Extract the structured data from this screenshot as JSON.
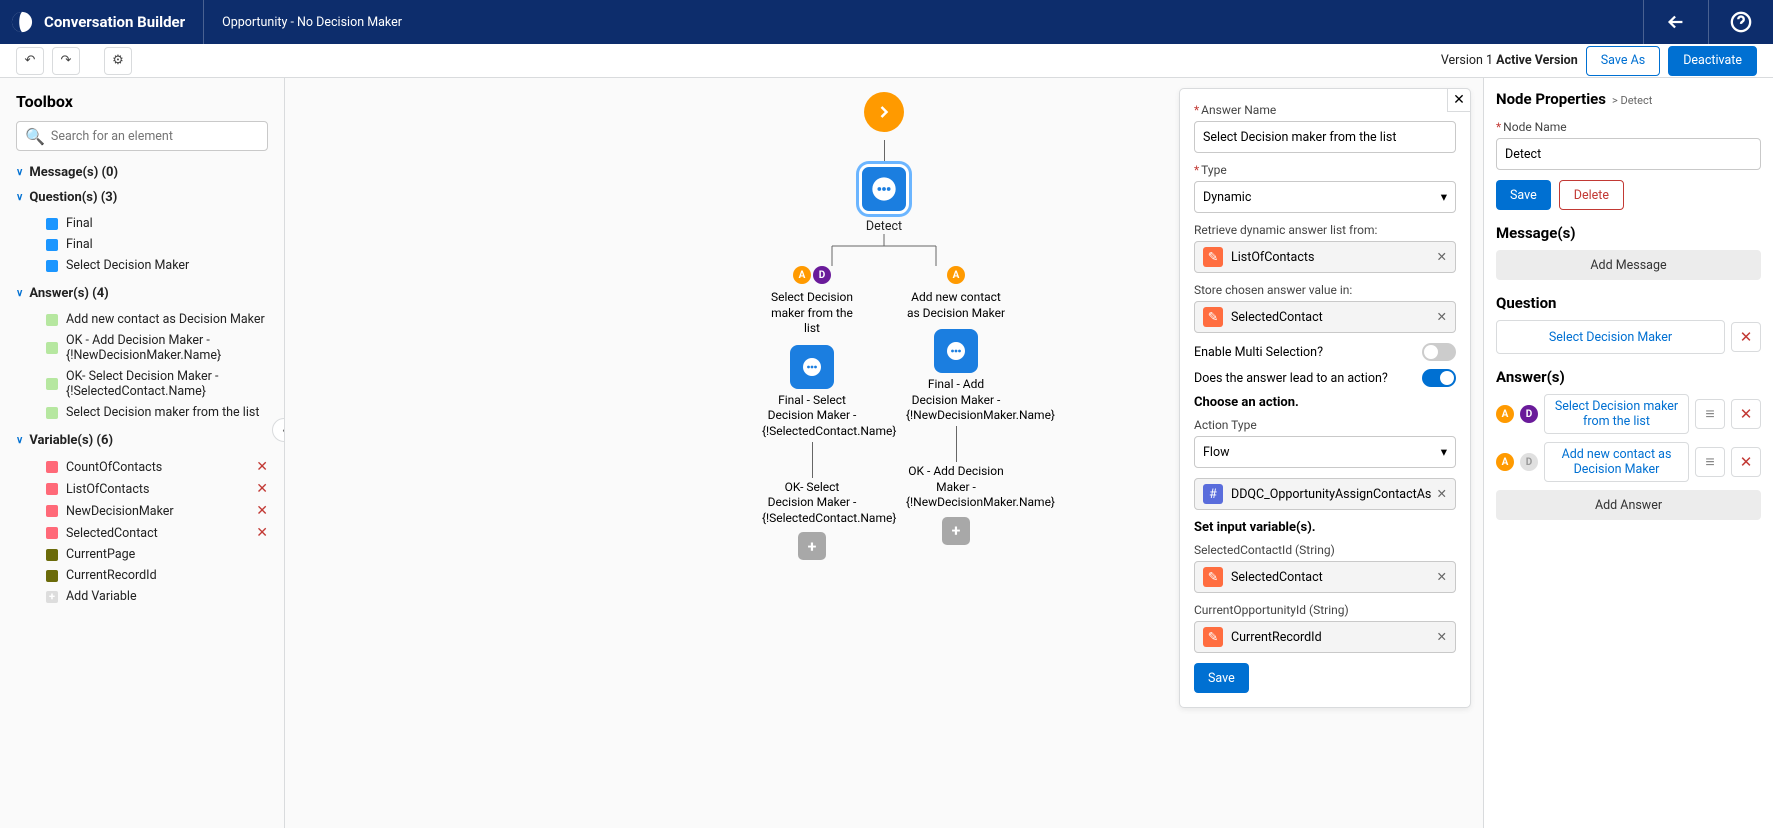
{
  "header": {
    "title": "Conversation Builder",
    "subtitle": "Opportunity - No Decision Maker"
  },
  "subbar": {
    "version": "Version 1 ",
    "version_state": "Active Version",
    "save_as": "Save As",
    "deactivate": "Deactivate"
  },
  "toolbox": {
    "title": "Toolbox",
    "search_placeholder": "Search for an element",
    "sections": {
      "messages": {
        "label": "Message(s) (0)",
        "items": []
      },
      "questions": {
        "label": "Question(s) (3)",
        "items": [
          "Final",
          "Final",
          "Select Decision Maker"
        ]
      },
      "answers": {
        "label": "Answer(s) (4)",
        "items": [
          "Add new contact as Decision Maker",
          "OK - Add Decision Maker - {!NewDecisionMaker.Name}",
          "OK- Select Decision Maker - {!SelectedContact.Name}",
          "Select Decision maker from the list"
        ]
      },
      "variables": {
        "label": "Variable(s) (6)",
        "items_del": [
          "CountOfContacts",
          "ListOfContacts",
          "NewDecisionMaker",
          "SelectedContact"
        ],
        "items_nodel": [
          "CurrentPage",
          "CurrentRecordId"
        ],
        "add": "Add Variable"
      }
    }
  },
  "canvas": {
    "detect_label": "Detect",
    "branch_left_circles": [
      "A",
      "D"
    ],
    "branch_right_circles": [
      "A"
    ],
    "left_answer": "Select Decision maker from the list",
    "right_answer": "Add new contact as Decision Maker",
    "left_final_label": "Final - Select Decision Maker - {!SelectedContact.Name}",
    "right_final_label": "Final - Add Decision Maker - {!NewDecisionMaker.Name}",
    "left_ok": "OK- Select Decision Maker - {!SelectedContact.Name}",
    "right_ok": "OK - Add Decision Maker - {!NewDecisionMaker.Name}"
  },
  "answer_panel": {
    "answer_name_label": "Answer Name",
    "answer_name_value": "Select Decision maker from the list",
    "type_label": "Type",
    "type_value": "Dynamic",
    "retrieve_label": "Retrieve dynamic answer list from:",
    "retrieve_value": "ListOfContacts",
    "store_label": "Store chosen answer value in:",
    "store_value": "SelectedContact",
    "multi_label": "Enable Multi Selection?",
    "lead_label": "Does the answer lead to an action?",
    "choose_action": "Choose an action.",
    "action_type_label": "Action Type",
    "action_type_value": "Flow",
    "flow_value": "DDQC_OpportunityAssignContactAs",
    "set_input": "Set input variable(s).",
    "var1_label": "SelectedContactId (String)",
    "var1_value": "SelectedContact",
    "var2_label": "CurrentOpportunityId (String)",
    "var2_value": "CurrentRecordId",
    "save": "Save"
  },
  "properties": {
    "title": "Node Properties",
    "crumb": "Detect",
    "node_name_label": "Node Name",
    "node_name_value": "Detect",
    "save": "Save",
    "delete": "Delete",
    "messages_title": "Message(s)",
    "add_message": "Add Message",
    "question_title": "Question",
    "question_link": "Select Decision Maker",
    "answers_title": "Answer(s)",
    "ans1": "Select Decision maker from the list",
    "ans2": "Add new contact as Decision Maker",
    "add_answer": "Add Answer"
  }
}
